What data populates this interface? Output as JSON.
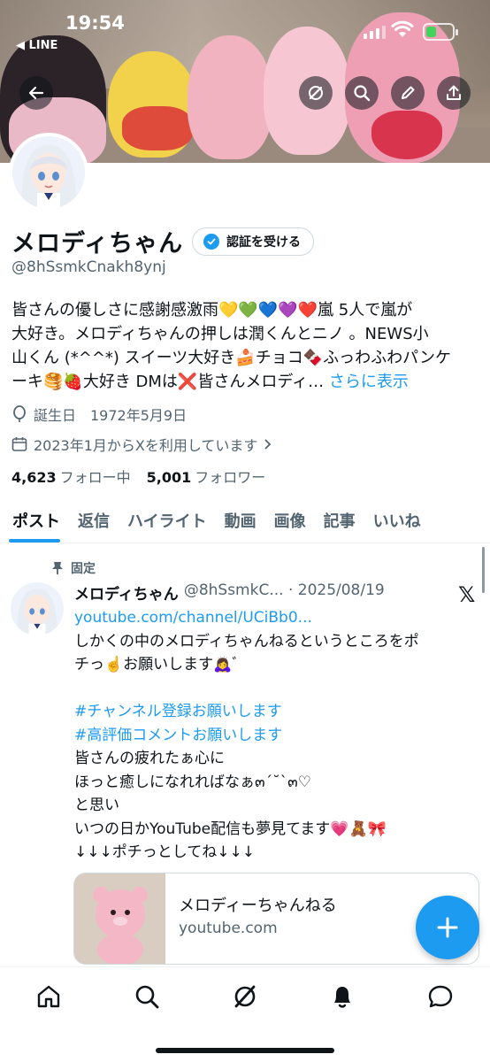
{
  "status_bar": {
    "time": "19:54",
    "back_app": "◀ LINE"
  },
  "profile": {
    "name": "メロディちゃん",
    "verify_label": "認証を受ける",
    "handle": "@8hSsmkCnakh8ynj",
    "bio_lines": [
      "皆さんの優しさに感謝感激雨💛💚💙💜❤️嵐 5人で嵐が",
      "大好き。メロディちゃんの押しは潤くんとニノ 。NEWS小",
      "山くん (*^^*) スイーツ大好き🍰チョコ🍫ふっわふわパンケ"
    ],
    "bio_last": "ーキ🥞🍓大好き DMは❌皆さんメロディ…",
    "bio_more": "さらに表示",
    "birthday": "誕生日　1972年5月9日",
    "joined": "2023年1月からXを利用しています",
    "following_count": "4,623",
    "following_label": "フォロー中",
    "followers_count": "5,001",
    "followers_label": "フォロワー"
  },
  "tabs": [
    "ポスト",
    "返信",
    "ハイライト",
    "動画",
    "画像",
    "記事",
    "いいね"
  ],
  "tweet": {
    "pinned_label": "固定",
    "author": "メロディちゃん",
    "handle_date": "@8hSsmkC... · 2025/08/19",
    "link": "youtube.com/channel/UCiBb0...",
    "line1": "しかくの中のメロディちゃんねるというところをポ",
    "line2": "チっ☝️お願いします🙇‍♀️ﾞ",
    "hashtag1": "#チャンネル登録お願いします",
    "hashtag2": "#高評価コメントお願いします",
    "line3": "皆さんの疲れたぁ心に",
    "line4": "ほっと癒しになれればなぁ๓´˘`๓♡",
    "line5": "と思い",
    "line6": "いつの日かYouTube配信も夢見てます💗🧸🎀",
    "line7": "↓↓↓ポチっとしてね↓↓↓",
    "card_title": "メロディーちゃんねる",
    "card_domain": "youtube.com"
  },
  "colors": {
    "accent": "#1d9bf0",
    "text": "#0f1419",
    "muted": "#536471"
  }
}
